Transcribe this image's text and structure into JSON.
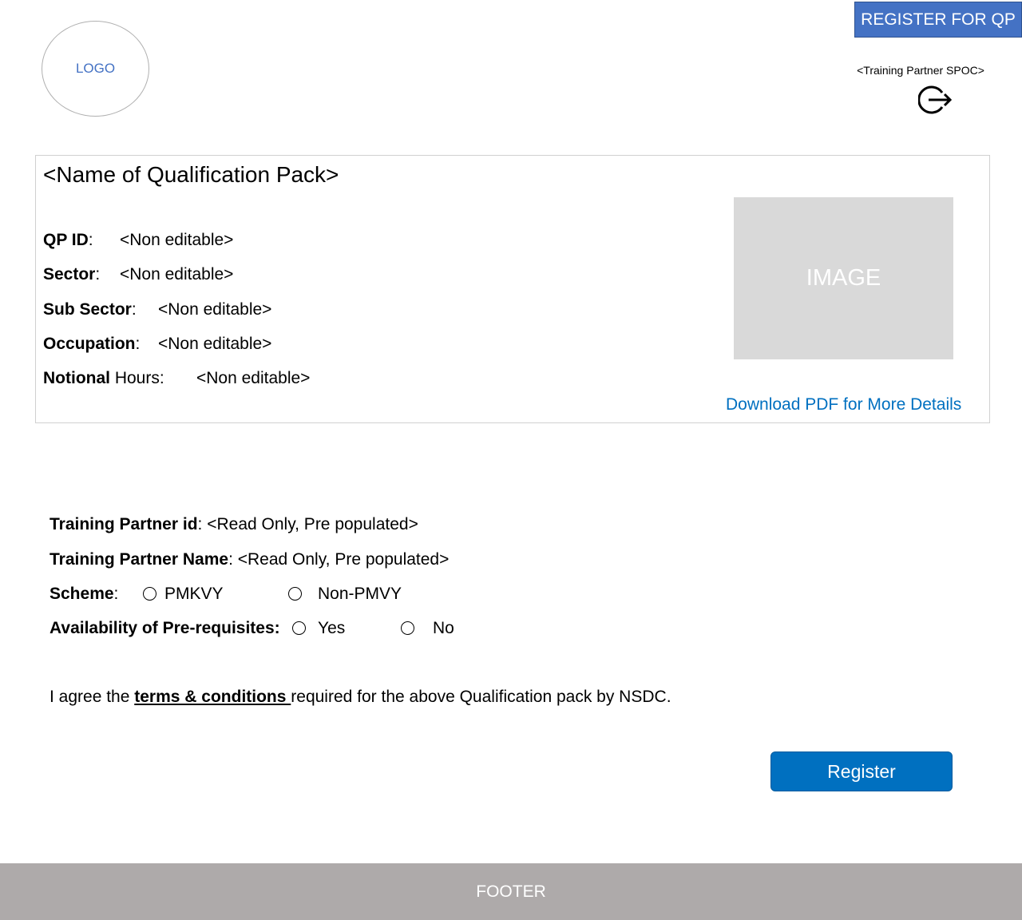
{
  "header": {
    "logo_text": "LOGO",
    "register_qp_label": "REGISTER FOR QP",
    "spoc_label": "<Training Partner SPOC>",
    "logout_icon": "logout-icon"
  },
  "qp": {
    "title": "<Name of Qualification Pack>",
    "fields": {
      "qp_id_label": "QP ID",
      "qp_id_value": "<Non editable>",
      "sector_label": "Sector",
      "sector_value": "<Non editable>",
      "sub_sector_label": "Sub Sector",
      "sub_sector_value": "<Non editable>",
      "occupation_label": "Occupation",
      "occupation_value": "<Non editable>",
      "notional_label_bold": "Notional",
      "notional_label_rest": " Hours:",
      "notional_value": "<Non editable>"
    },
    "image_text": "IMAGE",
    "download_label": "Download PDF for More Details"
  },
  "form": {
    "tp_id_label": "Training Partner id",
    "tp_id_value": ": <Read Only, Pre populated>",
    "tp_name_label": "Training Partner Name",
    "tp_name_value": ":  <Read Only, Pre populated>",
    "scheme_label": "Scheme",
    "scheme_options": [
      "PMKVY",
      "Non-PMVY"
    ],
    "prereq_label": "Availability of Pre-requisites:",
    "prereq_options": [
      "Yes",
      "No"
    ],
    "agree_prefix": "I agree the ",
    "terms_link": "terms & conditions ",
    "agree_suffix": "required for the above Qualification pack by NSDC.",
    "register_label": "Register"
  },
  "footer": {
    "text": "FOOTER"
  },
  "colors": {
    "top_button": "#4472c4",
    "register_button": "#0070c0",
    "link": "#0070c0",
    "image_placeholder": "#d9d9d9",
    "footer": "#aeaaaa"
  }
}
